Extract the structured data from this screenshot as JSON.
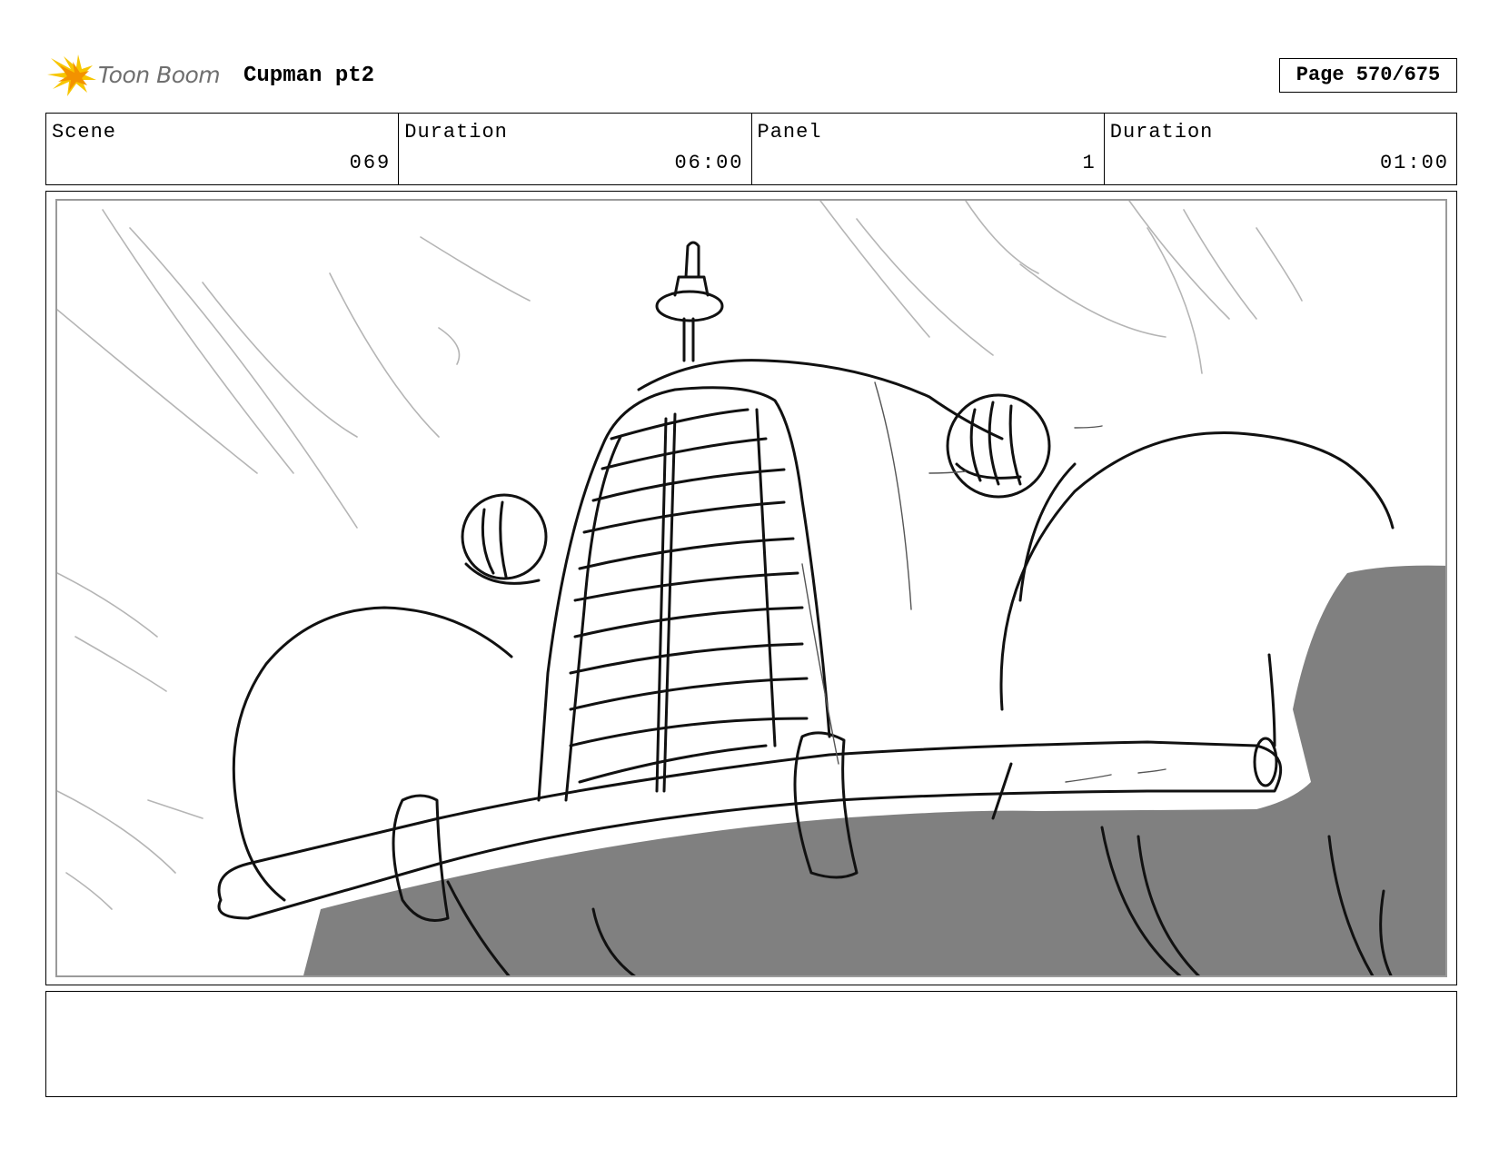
{
  "header": {
    "logo_text": "Toon Boom",
    "project_title": "Cupman pt2",
    "page_label": "Page 570/675"
  },
  "info": {
    "scene_label": "Scene",
    "scene_value": "069",
    "duration_label": "Duration",
    "duration_value": "06:00",
    "panel_label": "Panel",
    "panel_value": "1",
    "panel_duration_label": "Duration",
    "panel_duration_value": "01:00"
  },
  "panel": {
    "drawing": "sketch-car-front-low-angle-icon"
  },
  "notes": {
    "text": ""
  },
  "colors": {
    "logo_yellow": "#f7c600",
    "logo_orange": "#f39200",
    "shadow_gray": "#808080",
    "speed_line_gray": "#b5b5b5"
  }
}
